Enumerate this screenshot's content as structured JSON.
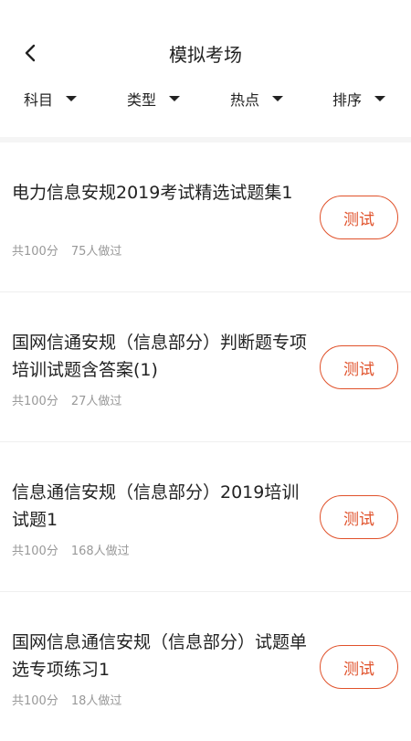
{
  "header": {
    "title": "模拟考场"
  },
  "filters": [
    {
      "label": "科目"
    },
    {
      "label": "类型"
    },
    {
      "label": "热点"
    },
    {
      "label": "排序"
    }
  ],
  "items": [
    {
      "title": "电力信息安规2019考试精选试题集1",
      "score": "共100分",
      "done": "75人做过",
      "button": "测试"
    },
    {
      "title": "国网信通安规（信息部分）判断题专项培训试题含答案(1)",
      "score": "共100分",
      "done": "27人做过",
      "button": "测试"
    },
    {
      "title": "信息通信安规（信息部分）2019培训试题1",
      "score": "共100分",
      "done": "168人做过",
      "button": "测试"
    },
    {
      "title": "国网信息通信安规（信息部分）试题单选专项练习1",
      "score": "共100分",
      "done": "18人做过",
      "button": "测试"
    }
  ]
}
